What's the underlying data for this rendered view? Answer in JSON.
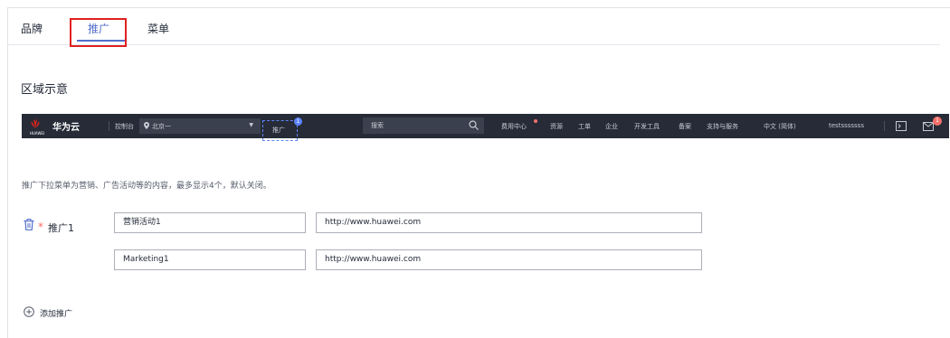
{
  "tabs": [
    {
      "label": "品牌"
    },
    {
      "label": "推广"
    },
    {
      "label": "菜单"
    }
  ],
  "section_title": "区域示意",
  "preview_nav": {
    "logo_small": "HUAWEI",
    "brand": "华为云",
    "console": "控制台",
    "region": "北京一",
    "promo": "推广",
    "promo_badge": "1",
    "search_placeholder": "搜索",
    "links": [
      "费用中心",
      "资源",
      "工单",
      "企业",
      "开发工具",
      "备案",
      "支持与服务",
      "中文 (简体)",
      "testsssssss"
    ],
    "notice_badge": "1"
  },
  "description": "推广下拉菜单为营销、广告活动等的内容，最多显示4个，默认关闭。",
  "promo_row": {
    "required_mark": "*",
    "label": "推广1",
    "name_cn": "营销活动1",
    "url_cn": "http://www.huawei.com",
    "name_en": "Marketing1",
    "url_en": "http://www.huawei.com"
  },
  "add_label": "添加推广",
  "colors": {
    "accent": "#526ecc",
    "highlight": "#e02020",
    "nav_bg": "#262b37",
    "red": "#f66f6a"
  }
}
